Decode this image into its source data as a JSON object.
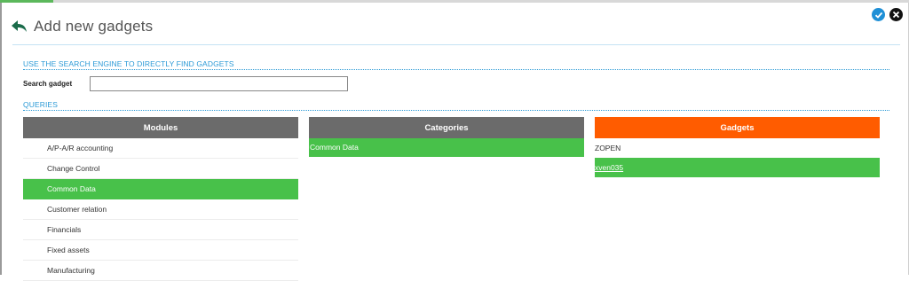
{
  "window": {
    "title": "Add new gadgets",
    "confirm_icon": "check-icon",
    "close_icon": "close-icon",
    "back_icon": "back-arrow-icon"
  },
  "search": {
    "section_title": "USE THE SEARCH ENGINE TO DIRECTLY FIND GADGETS",
    "label": "Search gadget",
    "value": "",
    "placeholder": ""
  },
  "queries": {
    "section_title": "QUERIES",
    "modules": {
      "header": "Modules",
      "items": [
        {
          "label": "A/P-A/R accounting",
          "selected": false
        },
        {
          "label": "Change Control",
          "selected": false
        },
        {
          "label": "Common Data",
          "selected": true
        },
        {
          "label": "Customer relation",
          "selected": false
        },
        {
          "label": "Financials",
          "selected": false
        },
        {
          "label": "Fixed assets",
          "selected": false
        },
        {
          "label": "Manufacturing",
          "selected": false
        }
      ]
    },
    "categories": {
      "header": "Categories",
      "items": [
        {
          "label": "Common Data",
          "selected": true
        }
      ]
    },
    "gadgets": {
      "header": "Gadgets",
      "items": [
        {
          "label": "ZOPEN",
          "selected": false
        },
        {
          "label": "xven035",
          "selected": true
        }
      ]
    }
  },
  "colors": {
    "accent_blue": "#2c9ad6",
    "selected_green": "#48c14a",
    "header_grey": "#6b6b6b",
    "header_orange": "#ff5c00"
  }
}
